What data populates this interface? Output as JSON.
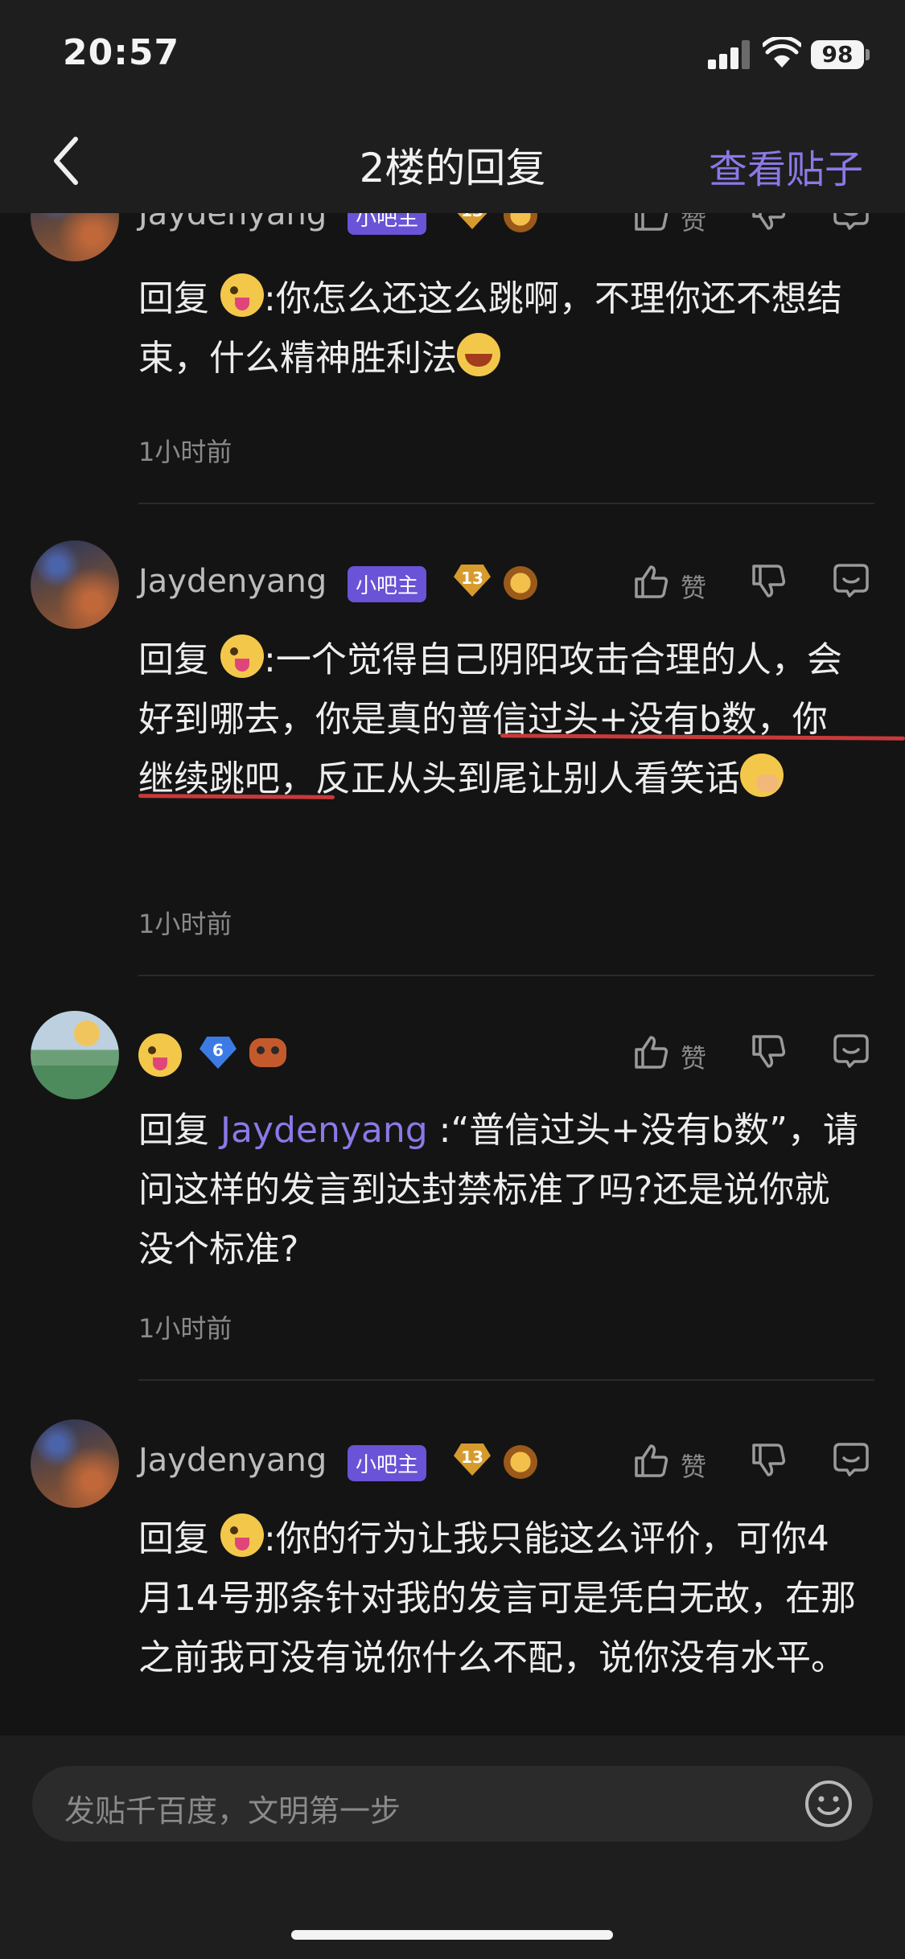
{
  "status_bar": {
    "time": "20:57",
    "battery": "98"
  },
  "nav": {
    "title": "2楼的回复",
    "action": "查看贴子"
  },
  "labels": {
    "like": "赞",
    "role_badge": "小吧主",
    "reply_prefix": "回复"
  },
  "replies": [
    {
      "username": "Jaydenyang",
      "level": "13",
      "mention": "",
      "text": ":你怎么还这么跳啊，不理你还不想结束，什么精神胜利法",
      "time": "1小时前"
    },
    {
      "username": "Jaydenyang",
      "level": "13",
      "mention": "",
      "text": ":一个觉得自己阴阳攻击合理的人，会好到哪去，你是真的普信过头+没有b数，你继续跳吧，反正从头到尾让别人看笑话",
      "time": "1小时前"
    },
    {
      "username": "",
      "level": "6",
      "mention": "Jaydenyang",
      "text": " :“普信过头+没有b数”，请问这样的发言到达封禁标准了吗?还是说你就没个标准?",
      "time": "1小时前"
    },
    {
      "username": "Jaydenyang",
      "level": "13",
      "mention": "",
      "text": ":你的行为让我只能这么评价，可你4月14号那条针对我的发言可是凭白无故，在那之前我可没有说你什么不配，说你没有水平。",
      "time": ""
    }
  ],
  "input": {
    "placeholder": "发贴千百度，文明第一步"
  },
  "colors": {
    "accent": "#8c78e6",
    "background": "#141414",
    "bar": "#1e1e1e",
    "annotation": "#c83a3a"
  }
}
